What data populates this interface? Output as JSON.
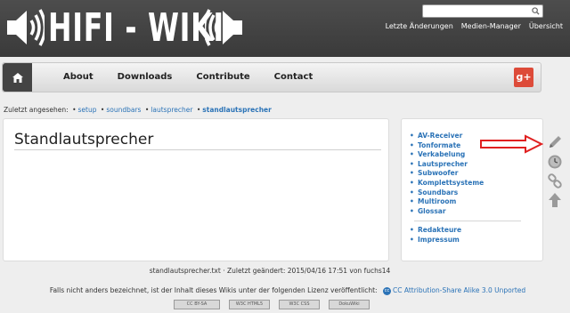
{
  "header": {
    "logo_text": "HIFI - WIKI",
    "search_placeholder": "",
    "top_links": [
      "Letzte Änderungen",
      "Medien-Manager",
      "Übersicht"
    ]
  },
  "nav": {
    "items": [
      "About",
      "Downloads",
      "Contribute",
      "Contact"
    ],
    "gplus_label": "g+"
  },
  "breadcrumb": {
    "prefix": "Zuletzt angesehen:",
    "items": [
      "setup",
      "soundbars",
      "lautsprecher",
      "standlautsprecher"
    ]
  },
  "page": {
    "title": "Standlautsprecher"
  },
  "sidebar": {
    "items": [
      "AV-Receiver",
      "Tonformate",
      "Verkabelung",
      "Lautsprecher",
      "Subwoofer",
      "Komplettsysteme",
      "Soundbars",
      "Multiroom",
      "Glossar"
    ],
    "items2": [
      "Redakteure",
      "Impressum"
    ]
  },
  "tools": [
    "pencil-icon",
    "clock-icon",
    "link-icon",
    "arrow-up-icon"
  ],
  "footer": {
    "docinfo": "standlautsprecher.txt · Zuletzt geändert: 2015/04/16 17:51 von fuchs14",
    "license_text": "Falls nicht anders bezeichnet, ist der Inhalt dieses Wikis unter der folgenden Lizenz veröffentlicht:",
    "license_link": "CC Attribution-Share Alike 3.0 Unported",
    "badges": [
      "CC BY-SA",
      "W3C HTML5",
      "W3C CSS",
      "DokuWiki"
    ]
  },
  "colors": {
    "header_bg": "#404040",
    "link": "#2b73b7",
    "gplus": "#dd4b39",
    "arrow": "#e02020"
  }
}
